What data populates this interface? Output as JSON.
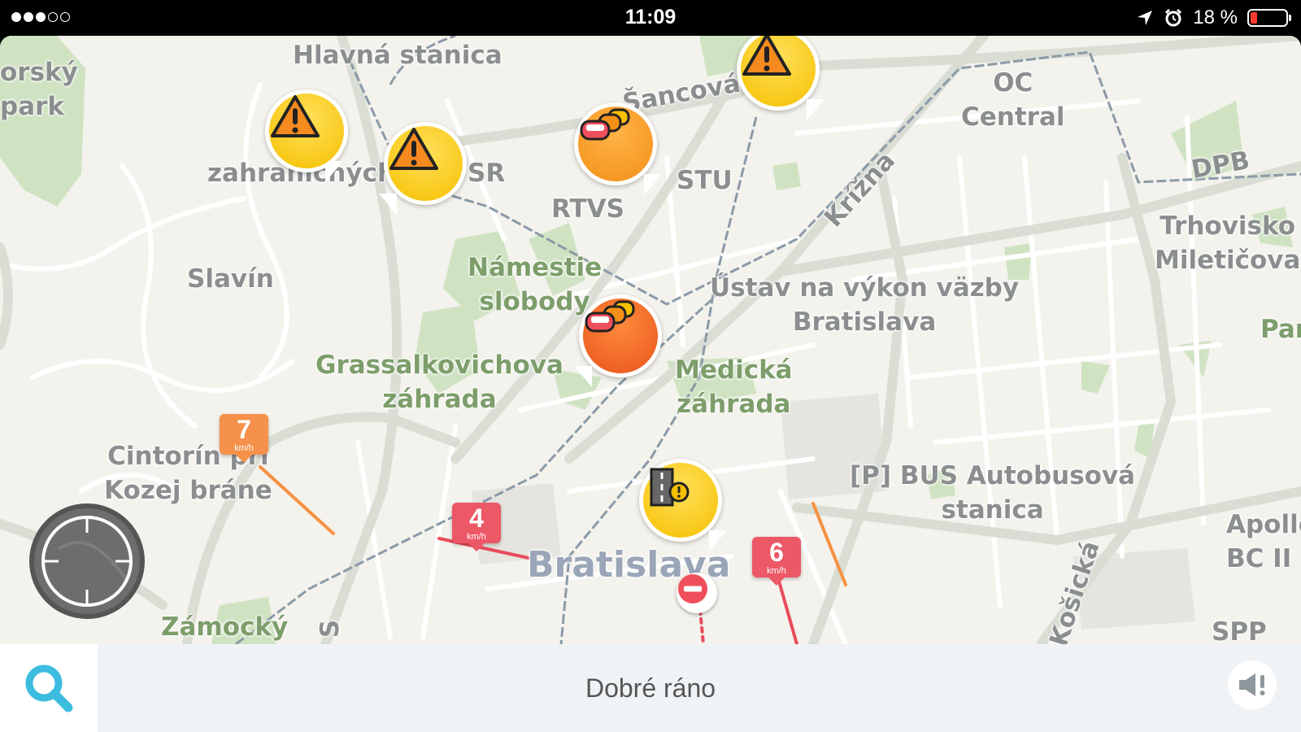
{
  "status_bar": {
    "signal_filled": 3,
    "signal_total": 5,
    "time": "11:09",
    "battery_percent_label": "18 %",
    "battery_level": 0.18,
    "battery_color": "#ff3b30"
  },
  "map": {
    "places": [
      {
        "id": "hlavna-stanica",
        "label": "Hlavná stanica",
        "style": "gray"
      },
      {
        "id": "sportovy-park",
        "label": "orský\npark",
        "style": "gray"
      },
      {
        "id": "sancova",
        "label": "Šancová",
        "style": "gray"
      },
      {
        "id": "oc-central",
        "label": "OC\nCentral",
        "style": "gray"
      },
      {
        "id": "zahranicnych",
        "label": "zahraničných",
        "style": "gray"
      },
      {
        "id": "sr",
        "label": "SR",
        "style": "gray"
      },
      {
        "id": "stu",
        "label": "STU",
        "style": "gray"
      },
      {
        "id": "rtvs",
        "label": "RTVS",
        "style": "gray"
      },
      {
        "id": "krizna",
        "label": "Krížna",
        "style": "gray"
      },
      {
        "id": "dpb",
        "label": "DPB",
        "style": "gray"
      },
      {
        "id": "trhovisko",
        "label": "Trhovisko\nMiletičova",
        "style": "gray"
      },
      {
        "id": "slavin",
        "label": "Slavín",
        "style": "gray"
      },
      {
        "id": "namestie",
        "label": "Námestie\nslobody",
        "style": "green"
      },
      {
        "id": "ustav",
        "label": "Ústav na výkon väzby\nBratislava",
        "style": "gray"
      },
      {
        "id": "par",
        "label": "Par",
        "style": "green"
      },
      {
        "id": "grassalkovichova",
        "label": "Grassalkovichova\nzáhrada",
        "style": "green"
      },
      {
        "id": "medicka",
        "label": "Medická\nzáhrada",
        "style": "green"
      },
      {
        "id": "cintorin",
        "label": "Cintorín pri\nKozej bráne",
        "style": "gray"
      },
      {
        "id": "bus",
        "label": "[P] BUS Autobusová\nstanica",
        "style": "gray"
      },
      {
        "id": "apollo",
        "label": "Apollo\nBC II",
        "style": "gray"
      },
      {
        "id": "bratislava",
        "label": "Bratislava",
        "style": "big"
      },
      {
        "id": "kosicka",
        "label": "Košická",
        "style": "gray"
      },
      {
        "id": "zamocky",
        "label": "Zámocký",
        "style": "green"
      },
      {
        "id": "s-road",
        "label": "S",
        "style": "gray"
      },
      {
        "id": "spp",
        "label": "SPP",
        "style": "gray"
      }
    ],
    "alerts": [
      {
        "id": "hazard-1",
        "type": "hazard",
        "icon": "warning-icon",
        "color": "yellow"
      },
      {
        "id": "hazard-2",
        "type": "hazard",
        "icon": "warning-icon",
        "color": "yellow"
      },
      {
        "id": "hazard-3",
        "type": "hazard",
        "icon": "warning-icon",
        "color": "yellow"
      },
      {
        "id": "traffic-1",
        "type": "traffic-jam",
        "icon": "traffic-jam-icon",
        "color": "orange"
      },
      {
        "id": "traffic-2",
        "type": "traffic-jam",
        "icon": "traffic-jam-icon",
        "color": "red"
      },
      {
        "id": "roadwork-1",
        "type": "road-hazard",
        "icon": "road-hazard-icon",
        "color": "yellow"
      }
    ],
    "speed_badges": [
      {
        "id": "speed-7",
        "speed": "7",
        "unit": "km/h",
        "color": "#f5914a"
      },
      {
        "id": "speed-4",
        "speed": "4",
        "unit": "km/h",
        "color": "#ec5866"
      },
      {
        "id": "speed-6",
        "speed": "6",
        "unit": "km/h",
        "color": "#ec5866"
      }
    ]
  },
  "bottom_bar": {
    "greeting": "Dobré ráno",
    "search_icon": "search-icon",
    "report_icon": "report-speaker-icon",
    "accent": "#3cbde0"
  }
}
